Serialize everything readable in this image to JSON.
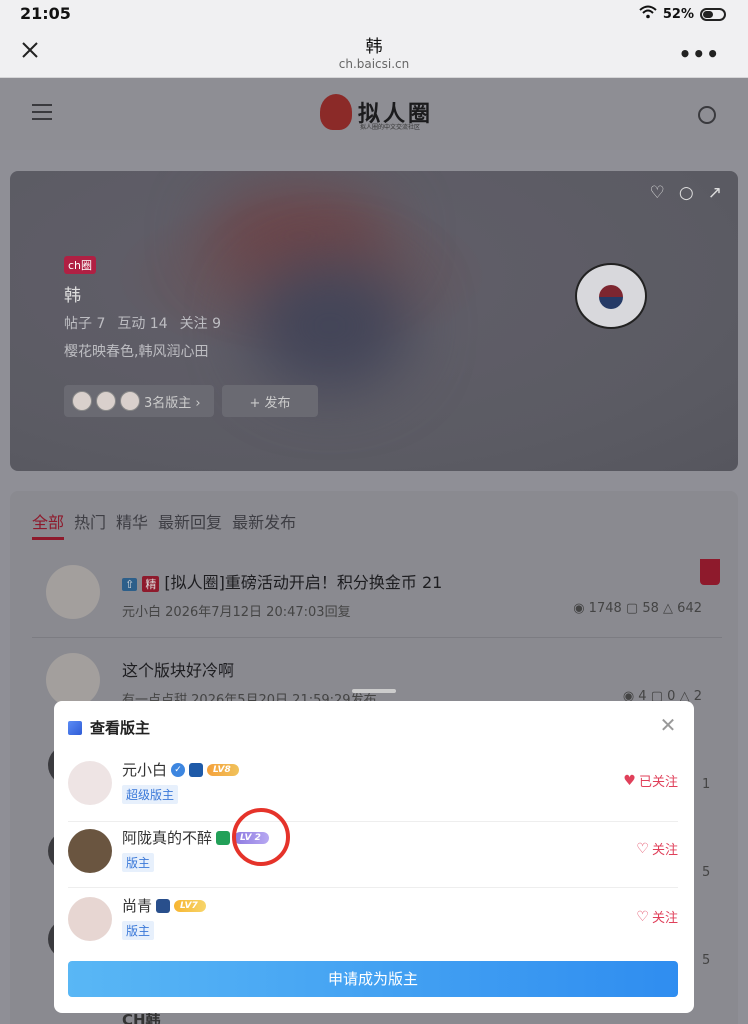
{
  "status_bar": {
    "time": "21:05",
    "battery": "52%"
  },
  "browser": {
    "title": "韩",
    "url": "ch.baicsi.cn"
  },
  "site": {
    "logo_text": "拟人圈",
    "logo_sub": "拟人圈的中文交流社区"
  },
  "hero": {
    "circle_badge": "ch圈",
    "name": "韩",
    "stats": [
      "帖子 7",
      "互动 14",
      "关注 9"
    ],
    "description": "樱花映春色,韩风润心田",
    "mods_label": "3名版主 ›",
    "post_button": "+ 发布"
  },
  "feed": {
    "tabs": [
      "全部",
      "热门",
      "精华",
      "最新回复",
      "最新发布"
    ],
    "posts": [
      {
        "tag_up": "⇧",
        "tag_jing": "精",
        "title": "[拟人圈]重磅活动开启！积分换金币",
        "image_count": "21",
        "author": "元小白",
        "time": "2026年7月12日 20:47:03回复",
        "views": "1748",
        "comments": "58",
        "likes": "642"
      },
      {
        "title": "这个版块好冷啊",
        "author": "有一点点甜",
        "time": "2026年5月20日 21:59:29发布",
        "views": "4",
        "comments": "0",
        "likes": "2"
      }
    ],
    "side_numbers": [
      "1",
      "5",
      "5"
    ],
    "last_author": "CH韩"
  },
  "modal": {
    "title": "查看版主",
    "moderators": [
      {
        "name": "元小白",
        "level": "LV8",
        "role": "超级版主",
        "follow": "已关注",
        "followed": true
      },
      {
        "name": "阿陇真的不醉",
        "level": "LV 2",
        "role": "版主",
        "follow": "关注",
        "followed": false
      },
      {
        "name": "尚青",
        "level": "LV7",
        "role": "版主",
        "follow": "关注",
        "followed": false
      }
    ],
    "apply_button": "申请成为版主"
  }
}
